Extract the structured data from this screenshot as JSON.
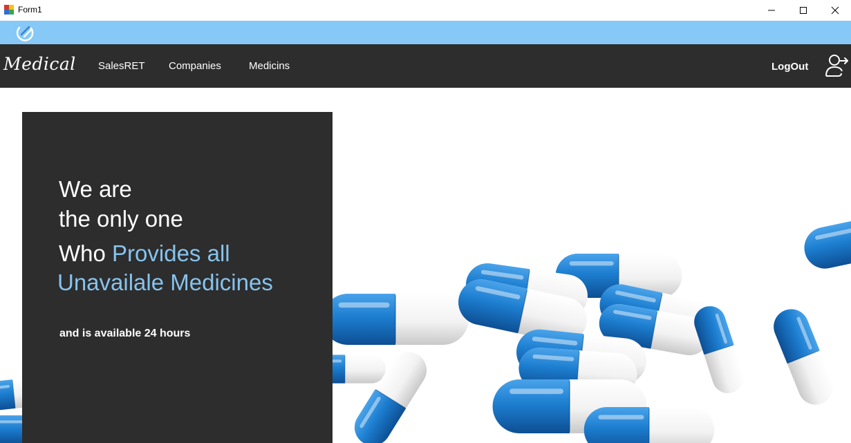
{
  "window": {
    "title": "Form1",
    "controls": [
      "minimize-icon",
      "maximize-icon",
      "close-icon"
    ]
  },
  "header": {
    "brand": "Medical",
    "nav_items": [
      {
        "label": "SalesRET"
      },
      {
        "label": "Companies"
      },
      {
        "label": "Medicins"
      }
    ],
    "logout_label": "LogOut",
    "logout_icon": "user-logout-icon"
  },
  "hero": {
    "line1": "We are",
    "line2": "the only one",
    "line3_prefix": "Who ",
    "line3_accent": "Provides all",
    "line4": "Unavailale Medicines",
    "subtext": "and is available 24 hours",
    "image": "blue-white-capsules-photo"
  },
  "colors": {
    "strip": "#86c9f6",
    "nav_background": "#2d2d2d",
    "panel": "#2d2d2d",
    "accent": "#86c3ee",
    "capsule_blue": "#1f79c9"
  }
}
